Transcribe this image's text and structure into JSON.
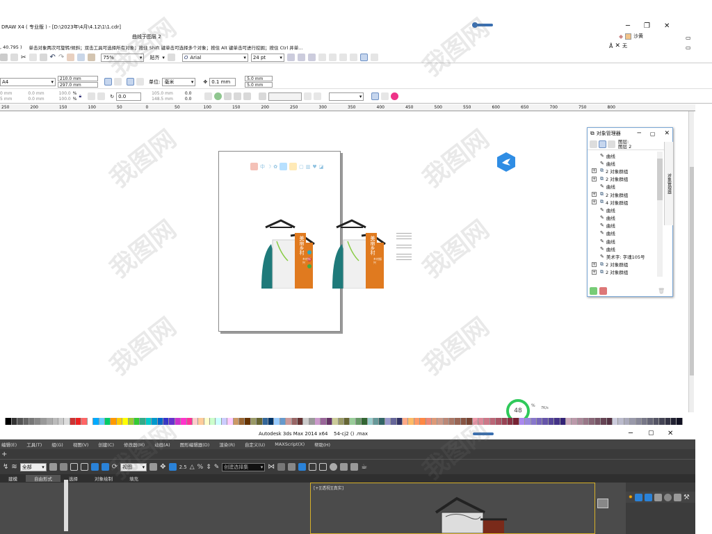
{
  "coreldraw": {
    "title": "DRAW X4 ( 专业版 ) - [D:\\2023年\\4月\\4.12\\1\\1.cdr]",
    "layer_status": "曲线于图层 2",
    "coords": ", 40.795 )",
    "hint": "单击对象两次可旋转/倾斜；双击工具可选择所有对象；按住 Shift 键单击可选择多个对象；按住 Alt 键单击可进行挖掘；按住 Ctrl 并单...",
    "fill_label": "沙黄",
    "outline_label": "无",
    "zoom": "75%",
    "snap": "贴齐",
    "font": "Arial",
    "font_size": "24 pt",
    "page_size": "A4",
    "width": "210.0 mm",
    "height": "297.0 mm",
    "unit_label": "单位:",
    "unit": "毫米",
    "nudge": "0.1 mm",
    "dup_x": "5.0 mm",
    "dup_y": "5.0 mm",
    "pos_x": "0 mm",
    "pos_y": "5 mm",
    "size_x": "0.0 mm",
    "size_y": "0.0 mm",
    "scale_x": "100.0",
    "scale_y": "100.0",
    "pct": "%",
    "angle": "0.0",
    "cx": "105.0 mm",
    "cy": "148.5 mm",
    "skew_x": "0.0",
    "skew_y": "0.0",
    "ruler_marks": [
      "250",
      "200",
      "150",
      "100",
      "50",
      "0",
      "50",
      "100",
      "150",
      "200",
      "250",
      "300",
      "350",
      "400",
      "450",
      "500",
      "550",
      "600",
      "650",
      "700",
      "750",
      "800"
    ]
  },
  "object_manager": {
    "title": "对象管理器",
    "layer_header": "图层:",
    "layer_name": "图层 2",
    "items": [
      {
        "plus": false,
        "label": "曲线"
      },
      {
        "plus": false,
        "label": "曲线"
      },
      {
        "plus": true,
        "label": "2 对象群组"
      },
      {
        "plus": true,
        "label": "2 对象群组"
      },
      {
        "plus": false,
        "label": "曲线"
      },
      {
        "plus": true,
        "label": "2 对象群组"
      },
      {
        "plus": true,
        "label": "4 对象群组"
      },
      {
        "plus": false,
        "label": "曲线"
      },
      {
        "plus": false,
        "label": "曲线"
      },
      {
        "plus": false,
        "label": "曲线"
      },
      {
        "plus": false,
        "label": "曲线"
      },
      {
        "plus": false,
        "label": "曲线"
      },
      {
        "plus": false,
        "label": "曲线"
      },
      {
        "plus": false,
        "label": "美术字:  字魂105号"
      },
      {
        "plus": true,
        "label": "2 对象群组"
      },
      {
        "plus": true,
        "label": "2 对象群组"
      }
    ],
    "side_tabs": "对象管理器"
  },
  "artwork": {
    "sign_text": "美丽乡村",
    "badge": "乡村振兴"
  },
  "bubble": {
    "value": "48",
    "sub": "%",
    "speed": "7K/s"
  },
  "max": {
    "title": "Autodesk 3ds Max  2014 x64",
    "file": "54-cj2 ()  .max",
    "menu": [
      "编辑(E)",
      "工具(T)",
      "组(G)",
      "视图(V)",
      "创建(C)",
      "修改器(M)",
      "动画(A)",
      "图形编辑器(D)",
      "渲染(R)",
      "自定义(U)",
      "MAXScript(X)",
      "帮助(H)"
    ],
    "select_filter": "全部",
    "view_mode": "视图",
    "named_sel": "创建选择集",
    "num_label": "2.5",
    "ribbon_tabs": [
      "建模",
      "自由形式",
      "选择",
      "对象绘制",
      "填充"
    ],
    "viewport_label": "[+][透视][真实]"
  },
  "watermark": "我图网",
  "colors": {
    "orange": "#e07a1f",
    "teal": "#1f7a7a",
    "green_circle": "#2fc95a",
    "max_bg": "#3c3c3c",
    "viewport_border": "#d8b12a"
  }
}
